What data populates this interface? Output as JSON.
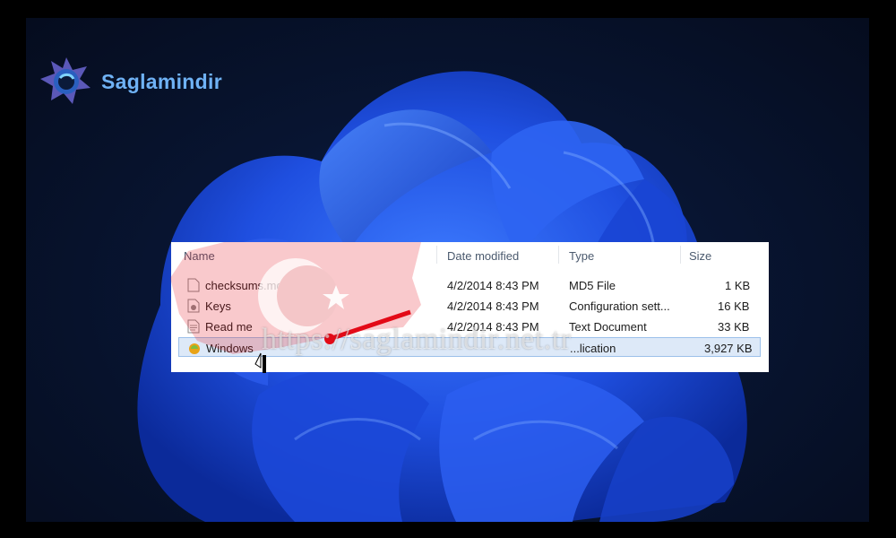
{
  "brand": {
    "name": "Saglamindir"
  },
  "explorer": {
    "columns": {
      "name": "Name",
      "date": "Date modified",
      "type": "Type",
      "size": "Size"
    },
    "files": [
      {
        "name": "checksums.md5",
        "date": "4/2/2014 8:43 PM",
        "type": "MD5 File",
        "size": "1 KB",
        "icon": "file-icon"
      },
      {
        "name": "Keys",
        "date": "4/2/2014 8:43 PM",
        "type": "Configuration sett...",
        "size": "16 KB",
        "icon": "config-file-icon"
      },
      {
        "name": "Read me",
        "date": "4/2/2014 8:43 PM",
        "type": "Text Document",
        "size": "33 KB",
        "icon": "text-file-icon"
      },
      {
        "name": "Windows",
        "date": "",
        "type": "...lication",
        "size": "3,927 KB",
        "icon": "application-icon",
        "selected": true
      }
    ]
  },
  "watermark": {
    "text": "https://saglamindir.net.tr"
  },
  "colors": {
    "brand": "#6fb2f5",
    "wallpaper_bloom": "#1a4fe0",
    "selection": "#dde9f8",
    "flag_red": "#e30a17"
  }
}
